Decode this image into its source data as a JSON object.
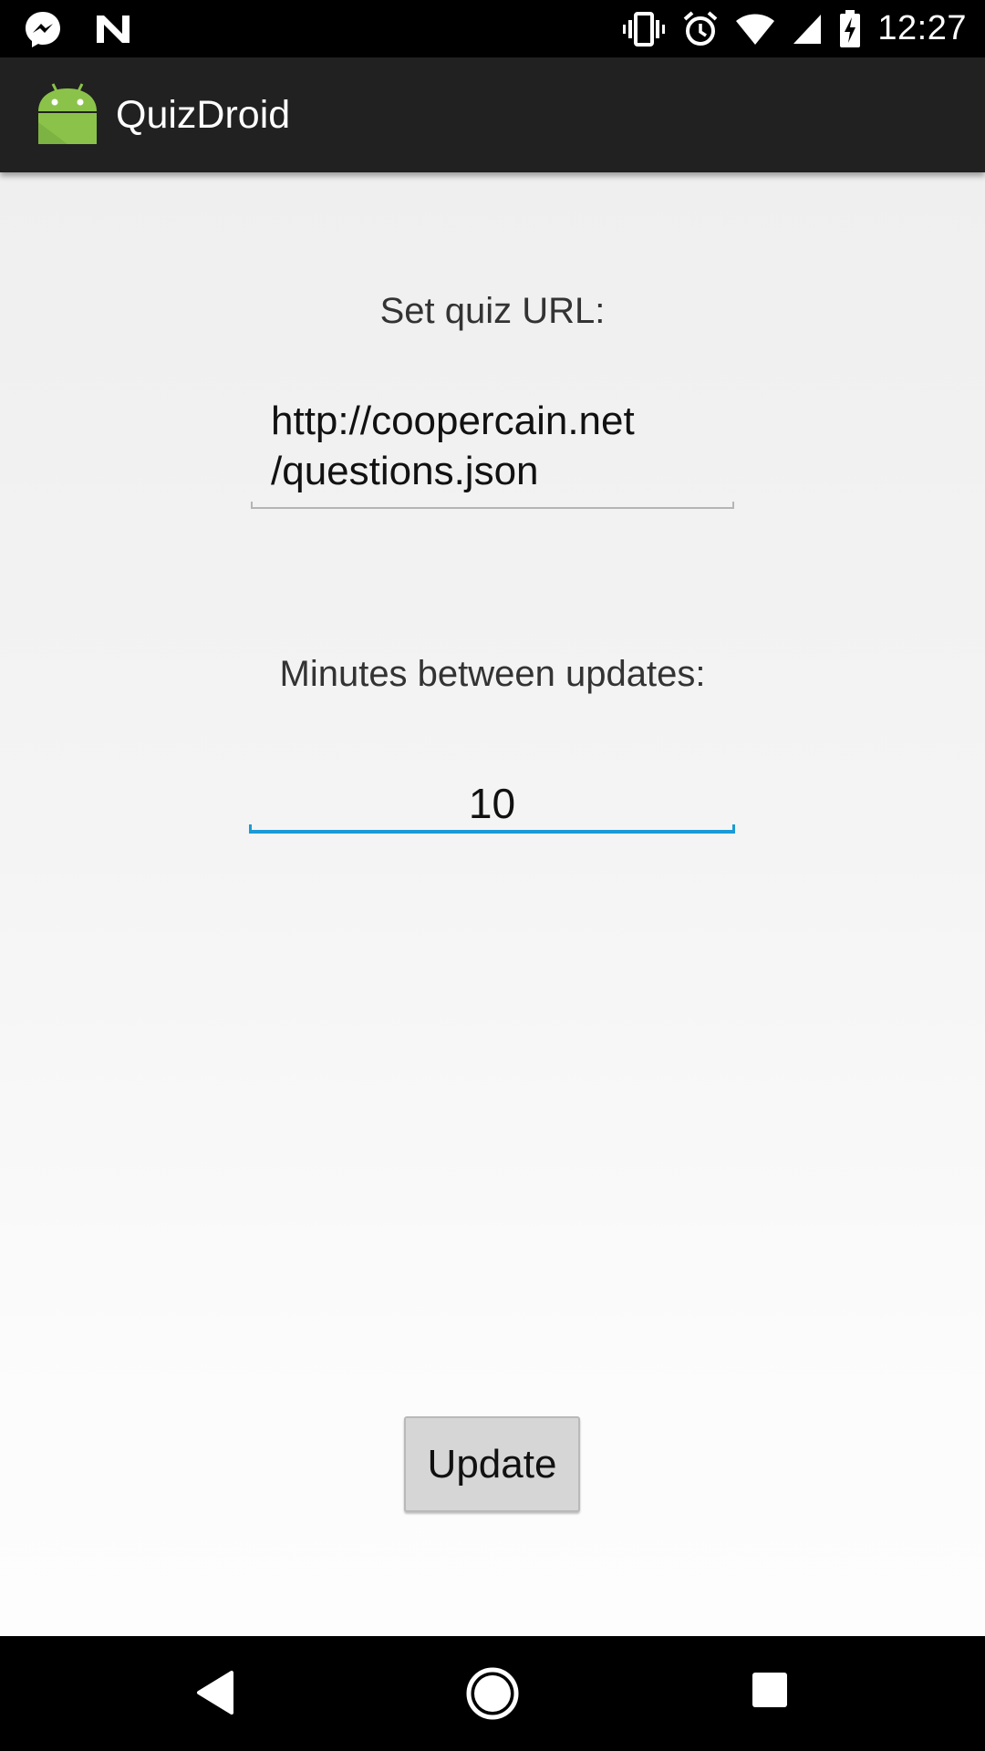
{
  "status_bar": {
    "time": "12:27",
    "left_icons": [
      "messenger-icon",
      "n-icon"
    ],
    "right_icons": [
      "vibrate-icon",
      "alarm-icon",
      "wifi-icon",
      "cell-signal-icon",
      "battery-charging-icon"
    ]
  },
  "action_bar": {
    "app_icon": "android-icon",
    "title": "QuizDroid"
  },
  "settings": {
    "url_label": "Set quiz URL:",
    "url_value": "http://coopercain.net/questions.json",
    "url_line1": "http://coopercain.net",
    "url_line2": "/questions.json",
    "minutes_label": "Minutes between updates:",
    "minutes_value": "10",
    "update_button": "Update"
  },
  "navigation": {
    "buttons": [
      "back-icon",
      "home-icon",
      "recents-icon"
    ]
  },
  "colors": {
    "status_bar": "#000000",
    "action_bar": "#212121",
    "accent": "#1a9ad6",
    "android_green": "#8bc34a",
    "background": "#efefef"
  }
}
